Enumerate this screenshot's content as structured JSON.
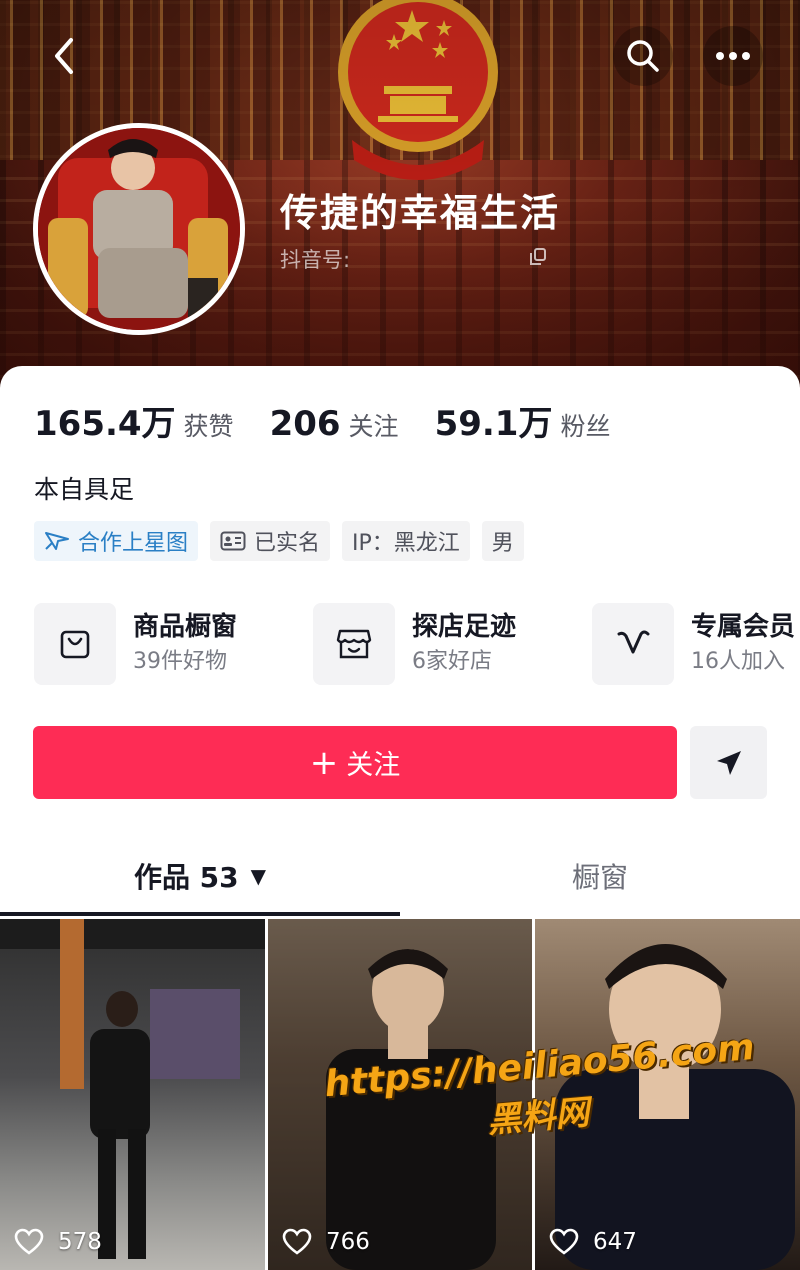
{
  "profile": {
    "nickname": "传捷的幸福生活",
    "account_label": "抖音号:",
    "bio": "本自具足"
  },
  "stats": [
    {
      "value": "165.4万",
      "label": "获赞"
    },
    {
      "value": "206",
      "label": "关注"
    },
    {
      "value": "59.1万",
      "label": "粉丝"
    }
  ],
  "tags": {
    "star": "合作上星图",
    "verified": "已实名",
    "ip": "IP：黑龙江",
    "gender": "男"
  },
  "services": [
    {
      "title": "商品橱窗",
      "subtitle": "39件好物",
      "icon": "shopping-bag-icon"
    },
    {
      "title": "探店足迹",
      "subtitle": "6家好店",
      "icon": "store-icon"
    },
    {
      "title": "专属会员",
      "subtitle": "16人加入",
      "icon": "v-badge-icon"
    }
  ],
  "actions": {
    "follow_plus": "+",
    "follow_label": "关注"
  },
  "tabs": {
    "works": "作品 53",
    "works_caret": "▼",
    "shop": "橱窗"
  },
  "videos": [
    {
      "likes": "578"
    },
    {
      "likes": "766"
    },
    {
      "likes": "647"
    }
  ],
  "watermark": {
    "url": "https://heiliao56.com",
    "name": "黑料网"
  },
  "colors": {
    "accent": "#fe2c55",
    "star_tag": "#2a7fc5",
    "watermark": "#f5a515"
  }
}
